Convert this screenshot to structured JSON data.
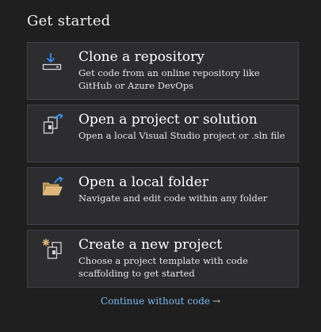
{
  "title": "Get started",
  "actions": [
    {
      "heading": "Clone a repository",
      "description": "Get code from an online repository like GitHub or Azure DevOps",
      "icon": "clone-download-icon"
    },
    {
      "heading": "Open a project or solution",
      "description": "Open a local Visual Studio project or .sln file",
      "icon": "open-project-icon"
    },
    {
      "heading": "Open a local folder",
      "description": "Navigate and edit code within any folder",
      "icon": "open-folder-icon"
    },
    {
      "heading": "Create a new project",
      "description": "Choose a project template with code scaffolding to get started",
      "icon": "new-project-icon"
    }
  ],
  "footer": {
    "continue_label": "Continue without code",
    "continue_arrow": "→"
  },
  "colors": {
    "background": "#1f1f1f",
    "card": "#2d2d30",
    "link": "#7cb9f2",
    "accent_blue": "#3794ff",
    "folder_yellow": "#dcb67a"
  }
}
